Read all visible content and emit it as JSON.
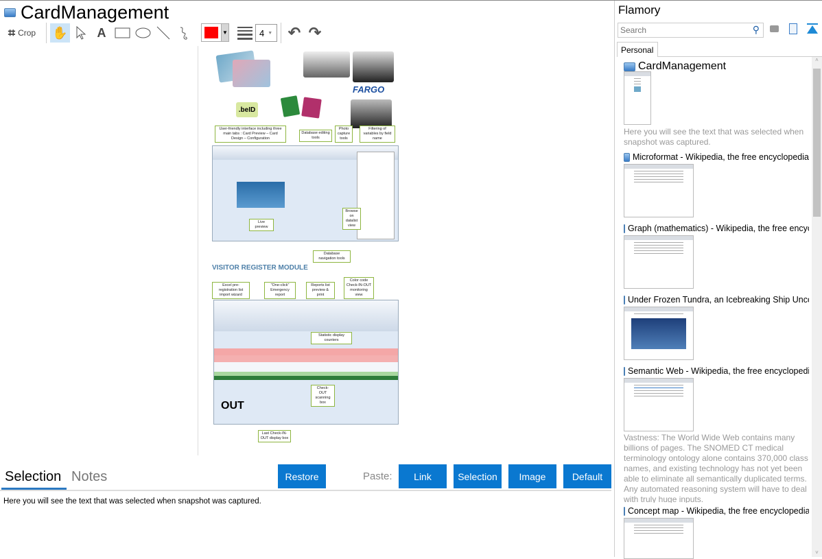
{
  "window": {
    "title": "CardManagement"
  },
  "toolbar": {
    "crop_label": "Crop",
    "line_width": "4",
    "color": "#ff0000",
    "tools": [
      "hand",
      "select",
      "text",
      "rectangle",
      "ellipse",
      "line",
      "freehand"
    ]
  },
  "document": {
    "brand": "FARGO",
    "beid": ".beID",
    "heading": "VISITOR REGISTER MODULE",
    "out": "OUT",
    "callouts": [
      "User-friendly interface including three main tabs : Card Preview – Card Design – Configuration",
      "Database editing tools",
      "Photo capture tools",
      "Filtering of variables by field name",
      "Live preview",
      "Browse on datalist view",
      "Database navigation tools",
      "Excel pre-registration list import wizard",
      "\"One-click\" Emergency report",
      "Reports list preview & print",
      "Color code Check-IN-OUT monitoring view",
      "Statistic display counters",
      "Check-OUT scanning box",
      "Last Check-IN-OUT display box"
    ]
  },
  "bottom": {
    "tabs": [
      "Selection",
      "Notes"
    ],
    "restore": "Restore",
    "paste_label": "Paste:",
    "paste_buttons": [
      "Link",
      "Selection",
      "Image",
      "Default"
    ],
    "selection_text": "Here you will see the text that was selected when snapshot was captured."
  },
  "sidebar": {
    "title": "Flamory",
    "search_placeholder": "Search",
    "tab": "Personal",
    "items": [
      {
        "title": "CardManagement",
        "desc": "Here you will see the text that was selected when snapshot was captured."
      },
      {
        "title": "Microformat - Wikipedia, the free encyclopedia"
      },
      {
        "title": "Graph (mathematics) - Wikipedia, the free encyclopedia"
      },
      {
        "title": "Under Frozen Tundra, an Icebreaking Ship Uncovers"
      },
      {
        "title": "Semantic Web - Wikipedia, the free encyclopedia",
        "desc": "Vastness: The World Wide Web contains many billions of pages. The SNOMED CT medical terminology ontology alone contains 370,000 class names, and existing technology has not yet been able to eliminate all semantically duplicated terms. Any automated reasoning system will have to deal with truly huge inputs."
      },
      {
        "title": "Concept map - Wikipedia, the free encyclopedia"
      }
    ]
  }
}
